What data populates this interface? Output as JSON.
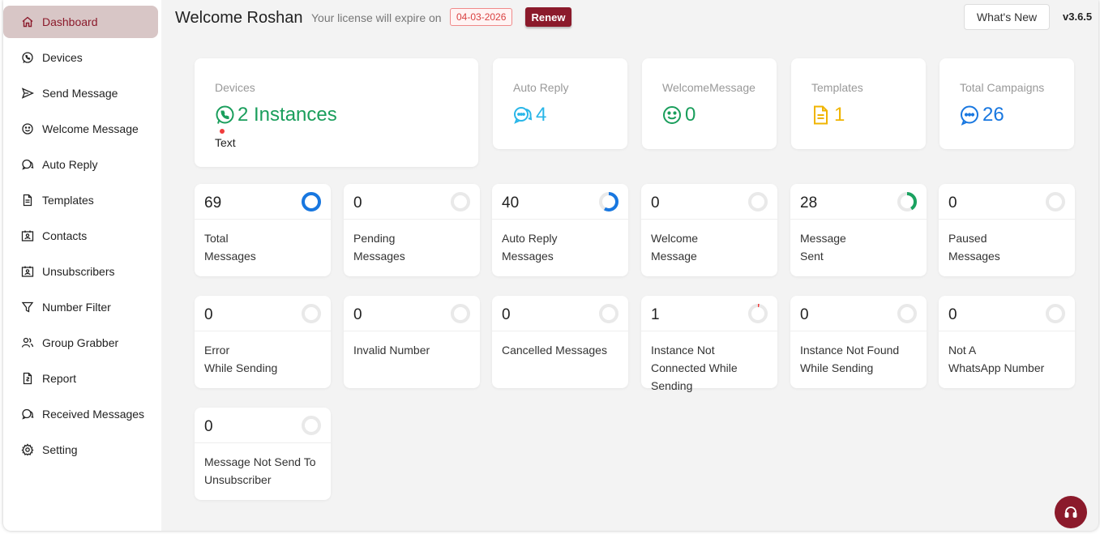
{
  "sidebar": {
    "items": [
      {
        "label": "Dashboard",
        "icon": "home-icon",
        "active": true
      },
      {
        "label": "Devices",
        "icon": "whatsapp-icon"
      },
      {
        "label": "Send Message",
        "icon": "send-icon"
      },
      {
        "label": "Welcome Message",
        "icon": "smile-icon"
      },
      {
        "label": "Auto Reply",
        "icon": "chat-icon"
      },
      {
        "label": "Templates",
        "icon": "file-icon"
      },
      {
        "label": "Contacts",
        "icon": "contact-card-icon"
      },
      {
        "label": "Unsubscribers",
        "icon": "contact-card-icon"
      },
      {
        "label": "Number Filter",
        "icon": "filter-icon"
      },
      {
        "label": "Group Grabber",
        "icon": "users-icon"
      },
      {
        "label": "Report",
        "icon": "report-icon"
      },
      {
        "label": "Received Messages",
        "icon": "chat-icon"
      },
      {
        "label": "Setting",
        "icon": "gear-icon"
      }
    ]
  },
  "header": {
    "welcome": "Welcome Roshan",
    "license_text": "Your license will expire on",
    "expiry_date": "04-03-2026",
    "renew_label": "Renew",
    "whats_new_label": "What's New",
    "version": "v3.6.5"
  },
  "summary": {
    "devices": {
      "label": "Devices",
      "value": "2 Instances",
      "sub": "Text",
      "icon": "whatsapp-icon",
      "color": "#1a9e5c"
    },
    "auto_reply": {
      "label": "Auto Reply",
      "value": "4",
      "icon": "chat-dots-icon",
      "color": "#29b6e8"
    },
    "welcome_message": {
      "label": "WelcomeMessage",
      "value": "0",
      "icon": "smile-icon",
      "color": "#1a9e5c"
    },
    "templates": {
      "label": "Templates",
      "value": "1",
      "icon": "file-icon",
      "color": "#f0b400"
    },
    "campaigns": {
      "label": "Total Campaigns",
      "value": "26",
      "icon": "chat-dots-icon",
      "color": "#1877e0"
    }
  },
  "stats": [
    {
      "value": "69",
      "lines": [
        "Total",
        "Messages"
      ],
      "progress": 1.0,
      "ring_color": "#1877e0"
    },
    {
      "value": "0",
      "lines": [
        "Pending",
        "Messages"
      ],
      "progress": 0,
      "ring_color": "#1877e0"
    },
    {
      "value": "40",
      "lines": [
        "Auto Reply",
        "Messages"
      ],
      "progress": 0.58,
      "ring_color": "#1877e0"
    },
    {
      "value": "0",
      "lines": [
        "Welcome",
        "Message"
      ],
      "progress": 0,
      "ring_color": "#1877e0"
    },
    {
      "value": "28",
      "lines": [
        "Message",
        "Sent"
      ],
      "progress": 0.41,
      "ring_color": "#1aa260"
    },
    {
      "value": "0",
      "lines": [
        "Paused",
        "Messages"
      ],
      "progress": 0,
      "ring_color": "#1877e0"
    },
    {
      "value": "0",
      "lines": [
        "Error",
        "While Sending"
      ],
      "progress": 0,
      "ring_color": "#1877e0"
    },
    {
      "value": "0",
      "lines": [
        "Invalid Number"
      ],
      "progress": 0,
      "ring_color": "#1877e0"
    },
    {
      "value": "0",
      "lines": [
        "Cancelled Messages"
      ],
      "progress": 0,
      "ring_color": "#1877e0"
    },
    {
      "value": "1",
      "lines": [
        "Instance Not",
        "Connected While",
        "Sending"
      ],
      "progress": 0.01,
      "ring_color": "#f03c3c"
    },
    {
      "value": "0",
      "lines": [
        "Instance Not Found",
        "While Sending"
      ],
      "progress": 0,
      "ring_color": "#1877e0"
    },
    {
      "value": "0",
      "lines": [
        "Not A",
        "WhatsApp Number"
      ],
      "progress": 0,
      "ring_color": "#1877e0"
    },
    {
      "value": "0",
      "lines": [
        "Message Not Send To",
        "Unsubscriber"
      ],
      "progress": 0,
      "ring_color": "#1877e0"
    }
  ],
  "colors": {
    "brand": "#8b1a2b",
    "active_bg": "#d8c6c6"
  },
  "help_icon": "headset-icon"
}
